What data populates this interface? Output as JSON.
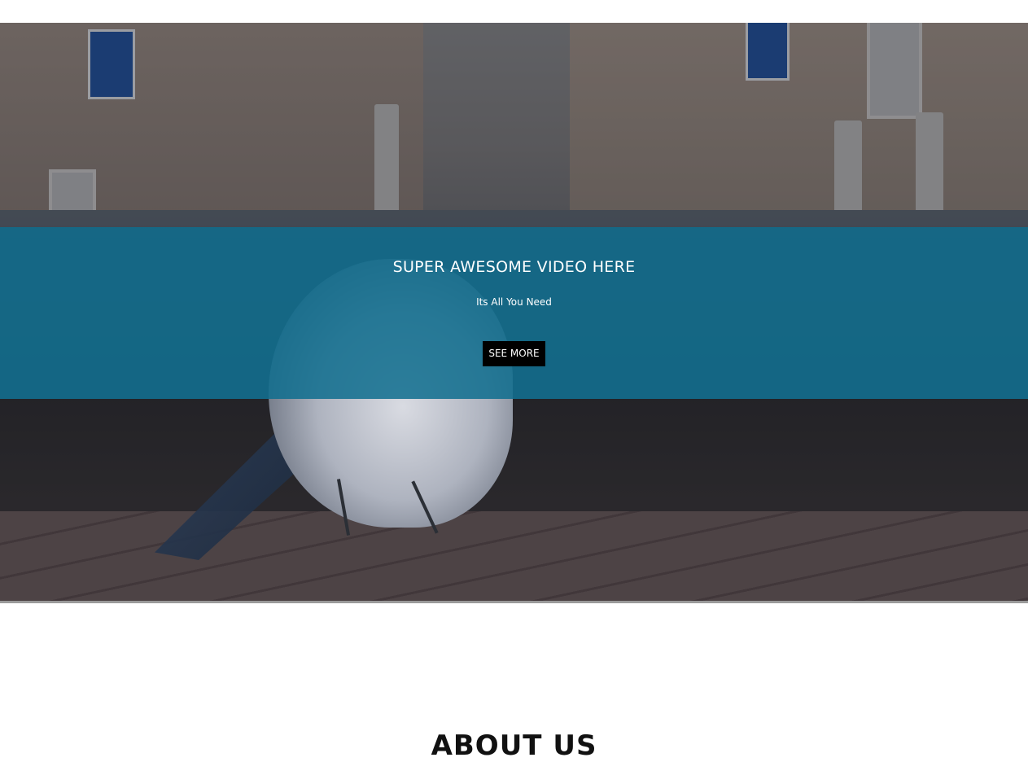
{
  "hero": {
    "background_image": "street-bird-photo",
    "overlay_color": "#0e6d8e",
    "title": "SUPER AWESOME VIDEO HERE",
    "subtitle": "Its All You Need",
    "button_label": "SEE MORE",
    "button_color": "#000000"
  },
  "about": {
    "heading": "ABOUT US"
  }
}
